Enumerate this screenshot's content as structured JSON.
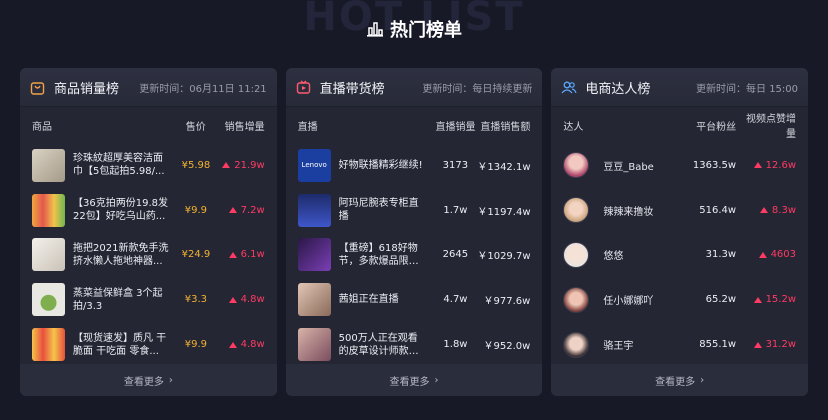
{
  "background_title": "HOT LIST",
  "page_title": "热门榜单",
  "colors": {
    "accent_red": "#ff3a63",
    "price_yellow": "#f2b233",
    "panel_bg": "#242633",
    "page_bg": "#171a26"
  },
  "more_label": "查看更多",
  "panels": [
    {
      "title": "商品销量榜",
      "icon": "shopping-bag-icon",
      "update_label": "更新时间：",
      "update_value": "06月11日 11:21",
      "columns": [
        "商品",
        "售价",
        "销售增量"
      ],
      "rows": [
        {
          "name": "珍珠紋超厚美容洁面巾【5包起拍5.98/...",
          "price": "¥5.98",
          "growth": "21.9w"
        },
        {
          "name": "【36克拍两份19.8发22包】好吃乌山药...",
          "price": "¥9.9",
          "growth": "7.2w"
        },
        {
          "name": "拖把2021新款免手洗挤水懒人拖地神器...",
          "price": "¥24.9",
          "growth": "6.1w"
        },
        {
          "name": "蒸菜益保鲜盒 3个起拍/3.3",
          "price": "¥3.3",
          "growth": "4.8w"
        },
        {
          "name": "【现货速发】质凡 干脆面 干吃面 零食...",
          "price": "¥9.9",
          "growth": "4.8w"
        }
      ]
    },
    {
      "title": "直播带货榜",
      "icon": "live-tv-icon",
      "update_label": "更新时间：",
      "update_value": "每日持续更新",
      "columns": [
        "直播",
        "直播销量",
        "直播销售额"
      ],
      "rows": [
        {
          "name": "好物联播精彩继续!",
          "sales": "3173",
          "amount": "￥1342.1w",
          "thumb_text": "Lenovo"
        },
        {
          "name": "阿玛尼腕表专柜直播",
          "sales": "1.7w",
          "amount": "￥1197.4w",
          "thumb_text": ""
        },
        {
          "name": "【重磅】618好物节，多款爆品限时...",
          "sales": "2645",
          "amount": "￥1029.7w",
          "thumb_text": ""
        },
        {
          "name": "茜姐正在直播",
          "sales": "4.7w",
          "amount": "￥977.6w",
          "thumb_text": ""
        },
        {
          "name": "500万人正在观看的皮草设计师款直播...",
          "sales": "1.8w",
          "amount": "￥952.0w",
          "thumb_text": ""
        }
      ]
    },
    {
      "title": "电商达人榜",
      "icon": "users-icon",
      "update_label": "更新时间：",
      "update_value": "每日 15:00",
      "columns": [
        "达人",
        "平台粉丝",
        "视频点赞增量"
      ],
      "rows": [
        {
          "name": "豆豆_Babe",
          "fans": "1363.5w",
          "growth": "12.6w"
        },
        {
          "name": "辣辣来撸妆",
          "fans": "516.4w",
          "growth": "8.3w"
        },
        {
          "name": "悠悠",
          "fans": "31.3w",
          "growth": "4603"
        },
        {
          "name": "任小娜娜吖",
          "fans": "65.2w",
          "growth": "15.2w"
        },
        {
          "name": "骆王宇",
          "fans": "855.1w",
          "growth": "31.2w"
        }
      ]
    }
  ]
}
